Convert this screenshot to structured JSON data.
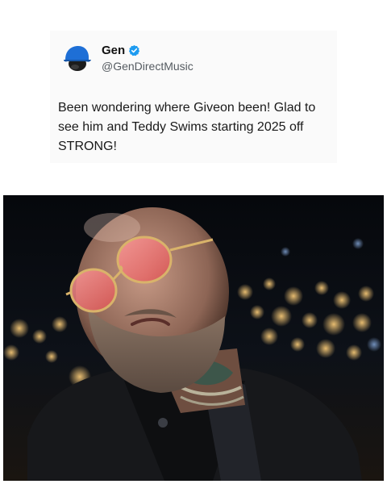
{
  "tweet": {
    "display_name": "Gen",
    "handle": "@GenDirectMusic",
    "verified": true,
    "avatar_icon": "cap-silhouette-avatar",
    "text": "Been wondering where Giveon been! Glad to see him and Teddy Swims starting 2025 off STRONG!"
  },
  "photo": {
    "icon": "photo-of-man-with-tinted-sunglasses-night-city-lights"
  },
  "colors": {
    "verified_blue": "#1d9bf0",
    "avatar_cap": "#1e6fd6"
  }
}
